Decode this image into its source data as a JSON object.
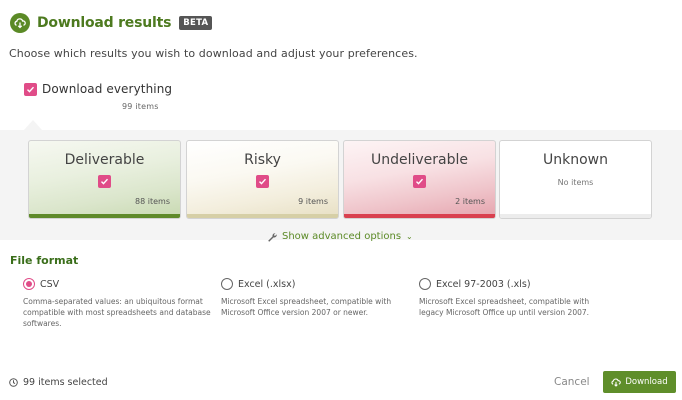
{
  "header": {
    "title": "Download results",
    "badge": "BETA",
    "icon": "cloud-download-icon"
  },
  "subtitle": "Choose which results you wish to download and adjust your preferences.",
  "download_everything": {
    "label": "Download everything",
    "checked": true,
    "count": "99 items"
  },
  "categories": [
    {
      "name": "Deliverable",
      "checked": true,
      "count": "88 items",
      "accent": "#5f8a2a"
    },
    {
      "name": "Risky",
      "checked": true,
      "count": "9 items",
      "accent": "#d6cfa6"
    },
    {
      "name": "Undeliverable",
      "checked": true,
      "count": "2 items",
      "accent": "#d9404f"
    },
    {
      "name": "Unknown",
      "checked": false,
      "count": "No items",
      "accent": "#ececec"
    }
  ],
  "advanced": {
    "label": "Show advanced options",
    "icon": "wrench-icon"
  },
  "file_format": {
    "title": "File format",
    "options": [
      {
        "label": "CSV",
        "selected": true,
        "description": "Comma-separated values: an ubiquitous format compatible with most spreadsheets and database softwares."
      },
      {
        "label": "Excel (.xlsx)",
        "selected": false,
        "description": "Microsoft Excel spreadsheet, compatible with Microsoft Office version 2007 or newer."
      },
      {
        "label": "Excel 97-2003 (.xls)",
        "selected": false,
        "description": "Microsoft Excel spreadsheet, compatible with legacy Microsoft Office up until version 2007."
      }
    ]
  },
  "footer": {
    "selected_text": "99 items selected",
    "cancel_label": "Cancel",
    "download_label": "Download"
  },
  "colors": {
    "brand": "#5b8a26",
    "checkbox": "#e04c88"
  }
}
